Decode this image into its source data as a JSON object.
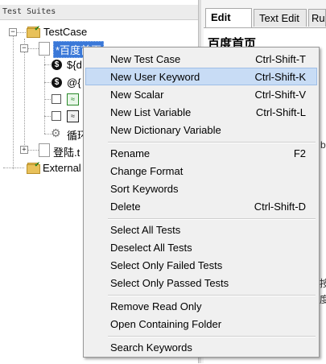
{
  "tree": {
    "header": "Test Suites",
    "items": {
      "testcase": "TestCase",
      "selected": "*百度首页",
      "dollar1": "${d",
      "dollar2": "@{",
      "loop": "循环",
      "login": "登陆.t",
      "external": "External"
    }
  },
  "editor": {
    "tabs": [
      "Edit",
      "Text Edit",
      "Ru"
    ],
    "page_title": "百度首页",
    "edge_chars": [
      "b",
      "按",
      "度"
    ]
  },
  "context_menu": {
    "groups": [
      [
        {
          "label": "New Test Case",
          "shortcut": "Ctrl-Shift-T"
        },
        {
          "label": "New User Keyword",
          "shortcut": "Ctrl-Shift-K",
          "highlighted": true
        },
        {
          "label": "New Scalar",
          "shortcut": "Ctrl-Shift-V"
        },
        {
          "label": "New List Variable",
          "shortcut": "Ctrl-Shift-L"
        },
        {
          "label": "New Dictionary Variable",
          "shortcut": ""
        }
      ],
      [
        {
          "label": "Rename",
          "shortcut": "F2"
        },
        {
          "label": "Change Format",
          "shortcut": ""
        },
        {
          "label": "Sort Keywords",
          "shortcut": ""
        },
        {
          "label": "Delete",
          "shortcut": "Ctrl-Shift-D"
        }
      ],
      [
        {
          "label": "Select All Tests",
          "shortcut": ""
        },
        {
          "label": "Deselect All Tests",
          "shortcut": ""
        },
        {
          "label": "Select Only Failed Tests",
          "shortcut": ""
        },
        {
          "label": "Select Only Passed Tests",
          "shortcut": ""
        }
      ],
      [
        {
          "label": "Remove Read Only",
          "shortcut": ""
        },
        {
          "label": "Open Containing Folder",
          "shortcut": ""
        }
      ],
      [
        {
          "label": "Search Keywords",
          "shortcut": ""
        }
      ]
    ]
  },
  "colors": {
    "selection": "#3a78d8",
    "menu_highlight": "#c8dcf5",
    "menu_bg": "#f0f0f0"
  }
}
